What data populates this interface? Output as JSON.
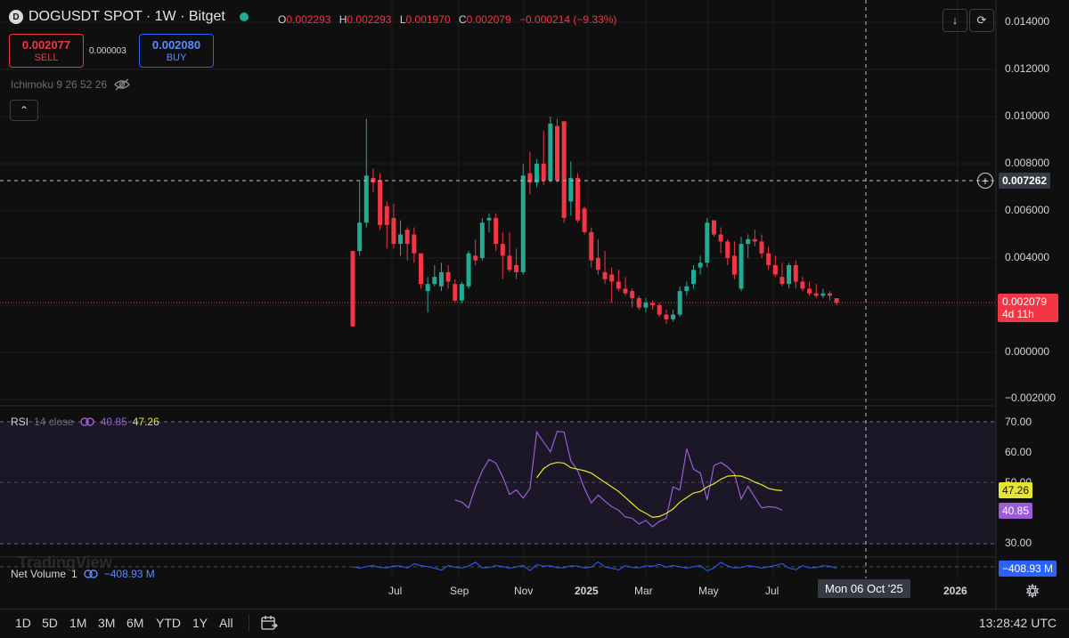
{
  "header": {
    "symbol_title": "DOGUSDT SPOT · 1W · Bitget",
    "coin_icon_letter": "D",
    "ohlc": [
      {
        "key": "O",
        "value": "0.002293"
      },
      {
        "key": "H",
        "value": "0.002293"
      },
      {
        "key": "L",
        "value": "0.001970"
      },
      {
        "key": "C",
        "value": "0.002079"
      }
    ],
    "change": "−0.000214 (−9.33%)"
  },
  "trade": {
    "sell_price": "0.002077",
    "sell_label": "SELL",
    "spread": "0.000003",
    "buy_price": "0.002080",
    "buy_label": "BUY"
  },
  "indicator": {
    "ichimoku": "Ichimoku 9 26 52 26",
    "collapse": "⌃"
  },
  "toolbar": {
    "download_icon": "↓",
    "refresh_icon": "⟳"
  },
  "price_axis": {
    "labels": [
      "0.014000",
      "0.012000",
      "0.010000",
      "0.008000",
      "0.006000",
      "0.004000",
      "0.000000",
      "−0.002000"
    ],
    "crosshair_price": "0.007262",
    "last_price": "0.002079",
    "countdown": "4d 11h"
  },
  "rsi": {
    "name": "RSI",
    "params": "14 close",
    "rsi_value": "40.85",
    "ma_value": "47.26",
    "axis_labels": [
      "70.00",
      "60.00",
      "50.00",
      "30.00"
    ],
    "tag_ma": "47.26",
    "tag_rsi": "40.85"
  },
  "net_volume": {
    "name": "Net Volume",
    "param": "1",
    "value": "−408.93 M",
    "tag": "−408.93 M"
  },
  "watermark": "TradingView",
  "time_axis": {
    "labels": [
      "Jul",
      "Sep",
      "Nov",
      "2025",
      "Mar",
      "May",
      "Jul",
      "2026"
    ],
    "crosshair_date": "Mon 06 Oct '25"
  },
  "timeframes": [
    "1D",
    "5D",
    "1M",
    "3M",
    "6M",
    "YTD",
    "1Y",
    "All"
  ],
  "clock": "13:28:42 UTC",
  "colors": {
    "up": "#22ab94",
    "down": "#f23645",
    "rsi": "#9c5cd6",
    "rsi_ma": "#e6e632",
    "netvol": "#2962ff",
    "bg": "#0f0f0f"
  },
  "chart_data": {
    "type": "candlestick",
    "y_range": [
      -0.002,
      0.014
    ],
    "candles": [
      {
        "o": 0.0043,
        "h": 0.0043,
        "l": 0.0011,
        "c": 0.0011
      },
      {
        "o": 0.0043,
        "h": 0.0073,
        "l": 0.0041,
        "c": 0.0055
      },
      {
        "o": 0.0055,
        "h": 0.0099,
        "l": 0.0053,
        "c": 0.0075
      },
      {
        "o": 0.0074,
        "h": 0.0078,
        "l": 0.0068,
        "c": 0.0072
      },
      {
        "o": 0.0073,
        "h": 0.0076,
        "l": 0.0052,
        "c": 0.0054
      },
      {
        "o": 0.0062,
        "h": 0.0064,
        "l": 0.0044,
        "c": 0.0054
      },
      {
        "o": 0.0057,
        "h": 0.0063,
        "l": 0.0044,
        "c": 0.0046
      },
      {
        "o": 0.0046,
        "h": 0.0056,
        "l": 0.0041,
        "c": 0.005
      },
      {
        "o": 0.0052,
        "h": 0.0053,
        "l": 0.0039,
        "c": 0.0046
      },
      {
        "o": 0.005,
        "h": 0.0053,
        "l": 0.0038,
        "c": 0.0042
      },
      {
        "o": 0.0042,
        "h": 0.0042,
        "l": 0.0027,
        "c": 0.0029
      },
      {
        "o": 0.0026,
        "h": 0.0032,
        "l": 0.0017,
        "c": 0.0029
      },
      {
        "o": 0.0029,
        "h": 0.0037,
        "l": 0.0028,
        "c": 0.0032
      },
      {
        "o": 0.0028,
        "h": 0.0038,
        "l": 0.0026,
        "c": 0.0034
      },
      {
        "o": 0.0034,
        "h": 0.0037,
        "l": 0.0027,
        "c": 0.003
      },
      {
        "o": 0.0029,
        "h": 0.0031,
        "l": 0.0021,
        "c": 0.0022
      },
      {
        "o": 0.0022,
        "h": 0.003,
        "l": 0.0021,
        "c": 0.0029
      },
      {
        "o": 0.0028,
        "h": 0.0043,
        "l": 0.0027,
        "c": 0.0042
      },
      {
        "o": 0.0041,
        "h": 0.0048,
        "l": 0.0037,
        "c": 0.0039
      },
      {
        "o": 0.004,
        "h": 0.0057,
        "l": 0.0039,
        "c": 0.0055
      },
      {
        "o": 0.0056,
        "h": 0.0059,
        "l": 0.0051,
        "c": 0.0057
      },
      {
        "o": 0.0057,
        "h": 0.0059,
        "l": 0.0043,
        "c": 0.0046
      },
      {
        "o": 0.0046,
        "h": 0.0051,
        "l": 0.0031,
        "c": 0.0041
      },
      {
        "o": 0.0041,
        "h": 0.0051,
        "l": 0.0034,
        "c": 0.0035
      },
      {
        "o": 0.0037,
        "h": 0.0044,
        "l": 0.0031,
        "c": 0.0034
      },
      {
        "o": 0.0034,
        "h": 0.008,
        "l": 0.0033,
        "c": 0.0075
      },
      {
        "o": 0.0076,
        "h": 0.0085,
        "l": 0.0067,
        "c": 0.0072
      },
      {
        "o": 0.0072,
        "h": 0.0082,
        "l": 0.007,
        "c": 0.008
      },
      {
        "o": 0.008,
        "h": 0.0094,
        "l": 0.0071,
        "c": 0.0073
      },
      {
        "o": 0.0073,
        "h": 0.01,
        "l": 0.0072,
        "c": 0.0097
      },
      {
        "o": 0.0096,
        "h": 0.0099,
        "l": 0.0072,
        "c": 0.0073
      },
      {
        "o": 0.0098,
        "h": 0.0098,
        "l": 0.0055,
        "c": 0.0057
      },
      {
        "o": 0.0064,
        "h": 0.0081,
        "l": 0.0058,
        "c": 0.0074
      },
      {
        "o": 0.0074,
        "h": 0.0076,
        "l": 0.0055,
        "c": 0.0056
      },
      {
        "o": 0.0061,
        "h": 0.0062,
        "l": 0.005,
        "c": 0.0051
      },
      {
        "o": 0.0051,
        "h": 0.0053,
        "l": 0.0036,
        "c": 0.0039
      },
      {
        "o": 0.004,
        "h": 0.0048,
        "l": 0.0033,
        "c": 0.0035
      },
      {
        "o": 0.0034,
        "h": 0.0043,
        "l": 0.0029,
        "c": 0.0031
      },
      {
        "o": 0.0033,
        "h": 0.0036,
        "l": 0.0021,
        "c": 0.003
      },
      {
        "o": 0.003,
        "h": 0.0035,
        "l": 0.0026,
        "c": 0.0027
      },
      {
        "o": 0.0027,
        "h": 0.0032,
        "l": 0.0024,
        "c": 0.0025
      },
      {
        "o": 0.0026,
        "h": 0.0027,
        "l": 0.0019,
        "c": 0.0023
      },
      {
        "o": 0.0023,
        "h": 0.0024,
        "l": 0.0018,
        "c": 0.0019
      },
      {
        "o": 0.0019,
        "h": 0.0023,
        "l": 0.0017,
        "c": 0.0021
      },
      {
        "o": 0.0021,
        "h": 0.0022,
        "l": 0.0018,
        "c": 0.002
      },
      {
        "o": 0.002,
        "h": 0.0021,
        "l": 0.0015,
        "c": 0.0016
      },
      {
        "o": 0.0016,
        "h": 0.0018,
        "l": 0.0012,
        "c": 0.0014
      },
      {
        "o": 0.0014,
        "h": 0.0018,
        "l": 0.0013,
        "c": 0.0016
      },
      {
        "o": 0.0016,
        "h": 0.0028,
        "l": 0.0015,
        "c": 0.0026
      },
      {
        "o": 0.0026,
        "h": 0.003,
        "l": 0.0024,
        "c": 0.0028
      },
      {
        "o": 0.0029,
        "h": 0.0037,
        "l": 0.0027,
        "c": 0.0035
      },
      {
        "o": 0.0036,
        "h": 0.0041,
        "l": 0.0033,
        "c": 0.0038
      },
      {
        "o": 0.0038,
        "h": 0.0057,
        "l": 0.0036,
        "c": 0.0055
      },
      {
        "o": 0.0056,
        "h": 0.0056,
        "l": 0.0049,
        "c": 0.005
      },
      {
        "o": 0.005,
        "h": 0.0053,
        "l": 0.0042,
        "c": 0.0047
      },
      {
        "o": 0.0047,
        "h": 0.0048,
        "l": 0.0037,
        "c": 0.004
      },
      {
        "o": 0.0041,
        "h": 0.0047,
        "l": 0.0031,
        "c": 0.0033
      },
      {
        "o": 0.0027,
        "h": 0.0049,
        "l": 0.0026,
        "c": 0.0046
      },
      {
        "o": 0.0046,
        "h": 0.005,
        "l": 0.004,
        "c": 0.0048
      },
      {
        "o": 0.0048,
        "h": 0.0052,
        "l": 0.0045,
        "c": 0.0047
      },
      {
        "o": 0.0047,
        "h": 0.005,
        "l": 0.004,
        "c": 0.0042
      },
      {
        "o": 0.0042,
        "h": 0.0045,
        "l": 0.0035,
        "c": 0.0037
      },
      {
        "o": 0.0037,
        "h": 0.0041,
        "l": 0.0032,
        "c": 0.0033
      },
      {
        "o": 0.0032,
        "h": 0.0038,
        "l": 0.0028,
        "c": 0.0029
      },
      {
        "o": 0.0029,
        "h": 0.0038,
        "l": 0.0027,
        "c": 0.0037
      },
      {
        "o": 0.0037,
        "h": 0.0039,
        "l": 0.0027,
        "c": 0.003
      },
      {
        "o": 0.003,
        "h": 0.0032,
        "l": 0.0026,
        "c": 0.0027
      },
      {
        "o": 0.0027,
        "h": 0.003,
        "l": 0.0024,
        "c": 0.0025
      },
      {
        "o": 0.0025,
        "h": 0.0029,
        "l": 0.0023,
        "c": 0.0024
      },
      {
        "o": 0.0024,
        "h": 0.0027,
        "l": 0.0023,
        "c": 0.0025
      },
      {
        "o": 0.0025,
        "h": 0.0026,
        "l": 0.0022,
        "c": 0.0024
      },
      {
        "o": 0.0023,
        "h": 0.0023,
        "l": 0.002,
        "c": 0.0021
      }
    ],
    "rsi": [
      44.2,
      43.5,
      41.6,
      48.5,
      53.8,
      57.5,
      56.3,
      51.8,
      46.0,
      47.5,
      44.8,
      48.0,
      66.5,
      63.2,
      60.0,
      66.7,
      66.5,
      57.0,
      53.8,
      48.0,
      43.2,
      45.8,
      43.8,
      42.0,
      40.8,
      38.6,
      38.2,
      36.3,
      37.5,
      35.4,
      37.2,
      38.2,
      48.5,
      47.5,
      61.0,
      54.3,
      53.0,
      44.2,
      55.5,
      56.5,
      55.0,
      52.8,
      44.5,
      48.7,
      45.0,
      41.6,
      42.0,
      41.8,
      40.85
    ],
    "rsi_ma": [
      51.5,
      54.5,
      56.0,
      56.5,
      56.3,
      54.8,
      54.3,
      53.8,
      53.0,
      51.5,
      50.0,
      48.5,
      47.0,
      45.0,
      43.0,
      41.0,
      39.8,
      38.5,
      38.8,
      39.8,
      41.2,
      43.5,
      45.0,
      46.5,
      47.0,
      48.5,
      49.5,
      51.0,
      52.0,
      52.2,
      52.0,
      51.2,
      50.0,
      49.2,
      48.0,
      47.5,
      47.26
    ],
    "x_labels": [
      "Jul",
      "Sep",
      "Nov",
      "2025",
      "Mar",
      "May",
      "Jul",
      "2026"
    ]
  }
}
